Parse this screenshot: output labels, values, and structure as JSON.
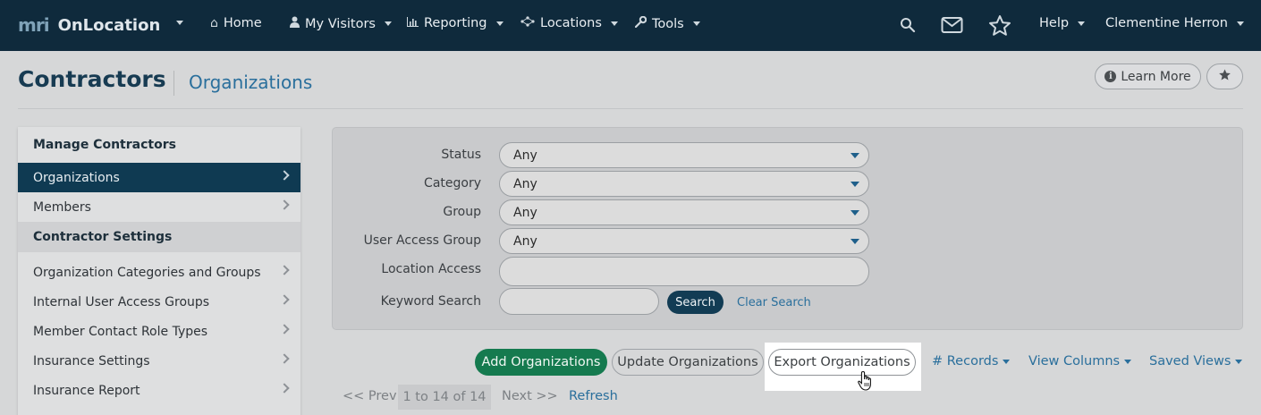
{
  "navbar": {
    "brand_mark": "mri",
    "brand_name": "OnLocation",
    "items": [
      {
        "label": "Home",
        "icon": "home-icon"
      },
      {
        "label": "My Visitors",
        "icon": "user-icon"
      },
      {
        "label": "Reporting",
        "icon": "bar-chart-icon"
      },
      {
        "label": "Locations",
        "icon": "network-icon"
      },
      {
        "label": "Tools",
        "icon": "wrench-icon"
      }
    ],
    "help_label": "Help",
    "user_name": "Clementine Herron"
  },
  "header": {
    "title": "Contractors",
    "subtitle": "Organizations",
    "learn_more_label": "Learn More",
    "info_glyph": "i"
  },
  "sidebar": {
    "heading_manage": "Manage Contractors",
    "manage_items": [
      {
        "label": "Organizations",
        "active": true
      },
      {
        "label": "Members",
        "active": false
      }
    ],
    "heading_settings": "Contractor Settings",
    "settings_items": [
      {
        "label": "Organization Categories and Groups"
      },
      {
        "label": "Internal User Access Groups"
      },
      {
        "label": "Member Contact Role Types"
      },
      {
        "label": "Insurance Settings"
      },
      {
        "label": "Insurance Report"
      }
    ]
  },
  "filters": {
    "status_label": "Status",
    "status_value": "Any",
    "category_label": "Category",
    "category_value": "Any",
    "group_label": "Group",
    "group_value": "Any",
    "user_access_label": "User Access Group",
    "user_access_value": "Any",
    "location_label": "Location Access",
    "location_value": "",
    "keyword_label": "Keyword Search",
    "keyword_value": "",
    "search_label": "Search",
    "clear_label": "Clear Search"
  },
  "actions": {
    "add_label": "Add Organizations",
    "update_label": "Update Organizations",
    "export_label": "Export Organizations",
    "records_label": "# Records",
    "view_columns_label": "View Columns",
    "saved_views_label": "Saved Views"
  },
  "pagination": {
    "prev_label": "<< Prev",
    "range_label": "1 to 14 of 14",
    "next_label": "Next >>",
    "refresh_label": "Refresh"
  },
  "colors": {
    "navbar_bg": "#0f2a3c",
    "active_item_bg": "#0f3a52",
    "primary_green": "#157a4f",
    "link_blue": "#2a6f9c"
  }
}
